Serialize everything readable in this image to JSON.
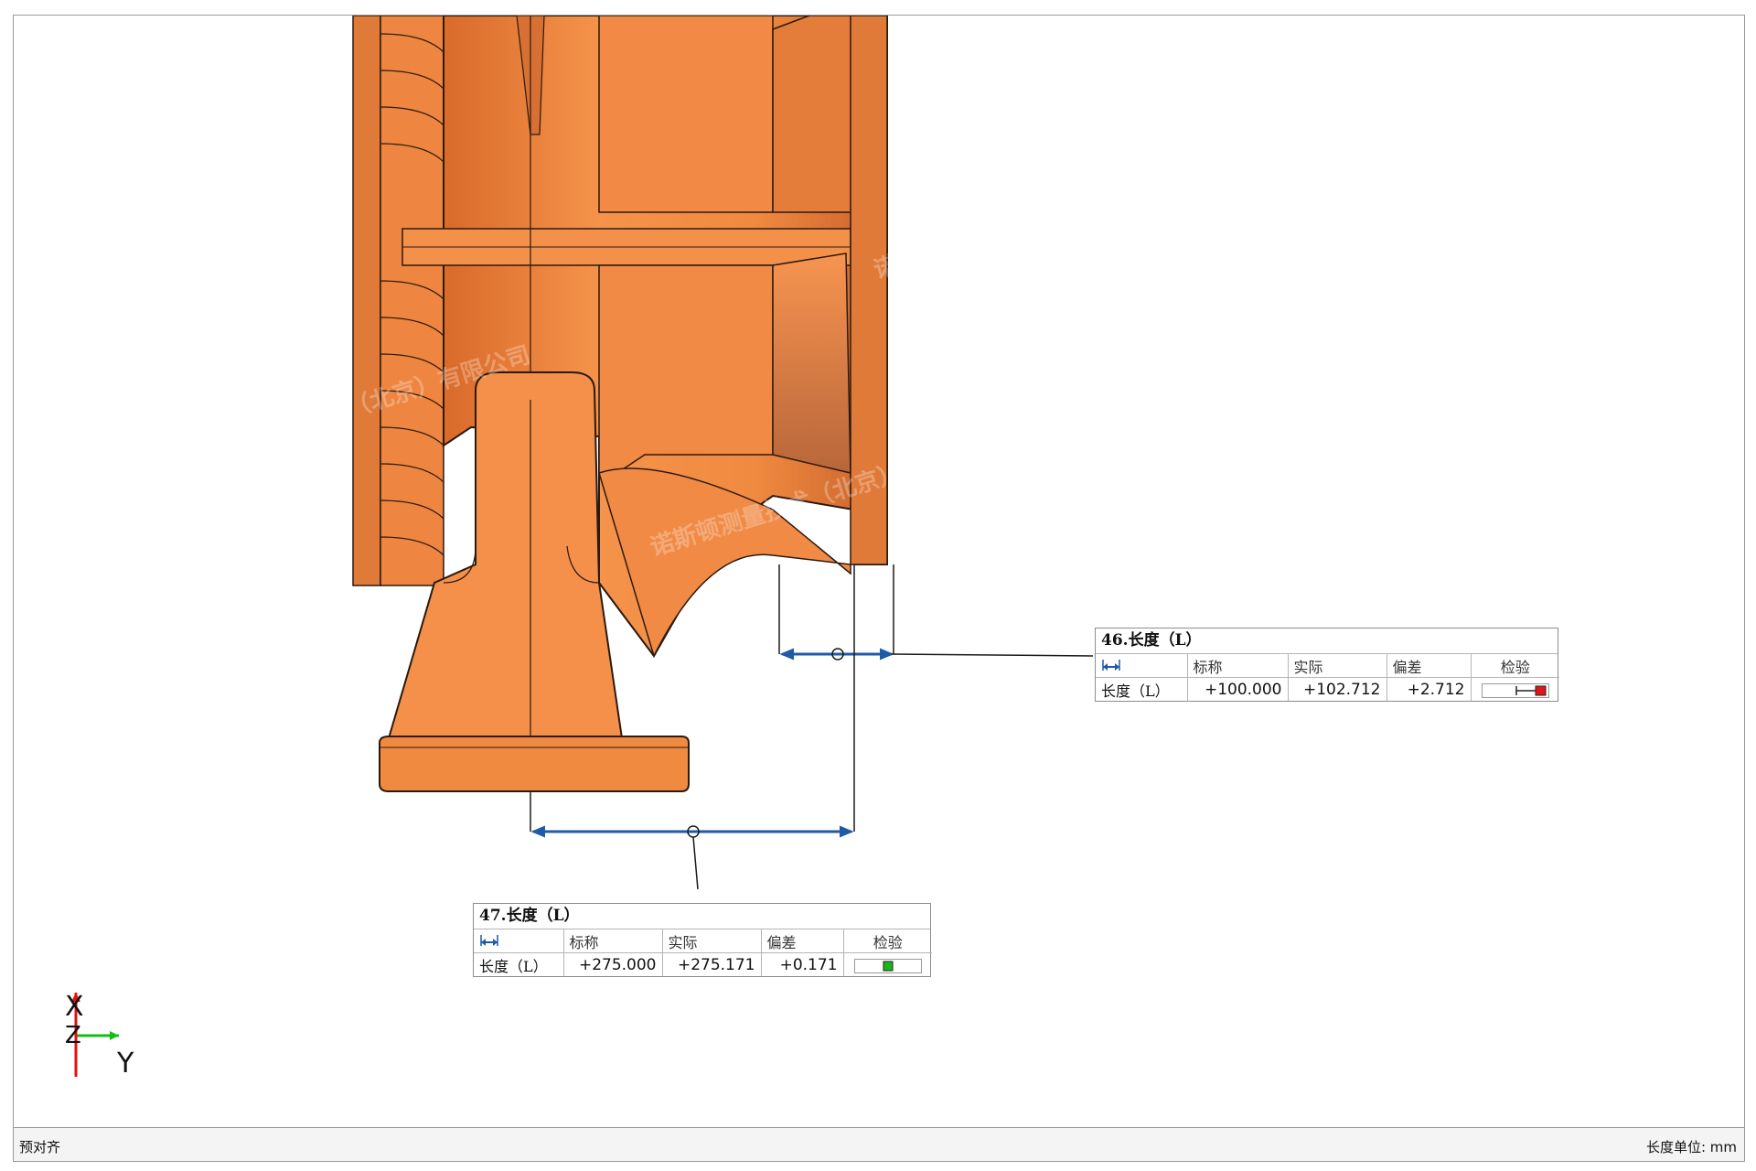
{
  "viewport": {
    "watermark_1": "（北京）有限公司",
    "watermark_2": "诺斯顿测量技术（北京）",
    "watermark_3": "诺"
  },
  "callouts": [
    {
      "title": "46.长度（L）",
      "headers": [
        "标称",
        "实际",
        "偏差",
        "检验"
      ],
      "row_label": "长度（L）",
      "nominal": "+100.000",
      "actual": "+102.712",
      "deviation": "+2.712",
      "status_color": "#e3141b",
      "status": "fail"
    },
    {
      "title": "47.长度（L）",
      "headers": [
        "标称",
        "实际",
        "偏差",
        "检验"
      ],
      "row_label": "长度（L）",
      "nominal": "+275.000",
      "actual": "+275.171",
      "deviation": "+0.171",
      "status_color": "#18b818",
      "status": "pass"
    }
  ],
  "axes": {
    "x_label": "X",
    "y_label": "Y",
    "z_label": "Z",
    "x_color": "#e01010",
    "y_color": "#10c010"
  },
  "colors": {
    "part_fill": "#f08a40",
    "part_shadow": "#c9612a",
    "dimension_line": "#1f5aa6"
  },
  "statusbar": {
    "left_text": "预对齐",
    "units_text": "长度单位: mm"
  }
}
